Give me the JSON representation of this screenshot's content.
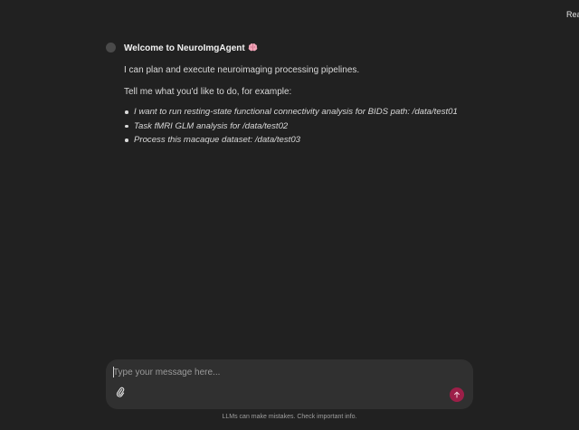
{
  "status": {
    "corner_text": "Ready"
  },
  "message": {
    "title": "Welcome to NeuroImgAgent",
    "title_icon": "brain-icon",
    "intro": "I can plan and execute neuroimaging processing pipelines.",
    "prompt": "Tell me what you'd like to do, for example:",
    "examples": [
      "I want to run resting-state functional connectivity analysis for BIDS path: /data/test01",
      "Task fMRI GLM analysis for /data/test02",
      "Process this macaque dataset: /data/test03"
    ]
  },
  "composer": {
    "placeholder": "Type your message here...",
    "attach_icon": "paperclip-icon",
    "send_icon": "arrow-up-icon",
    "send_color": "#9c1f48"
  },
  "footer": {
    "disclaimer": "LLMs can make mistakes. Check important info."
  },
  "colors": {
    "background": "#212121",
    "composer_bg": "#303030",
    "accent": "#9c1f48"
  }
}
